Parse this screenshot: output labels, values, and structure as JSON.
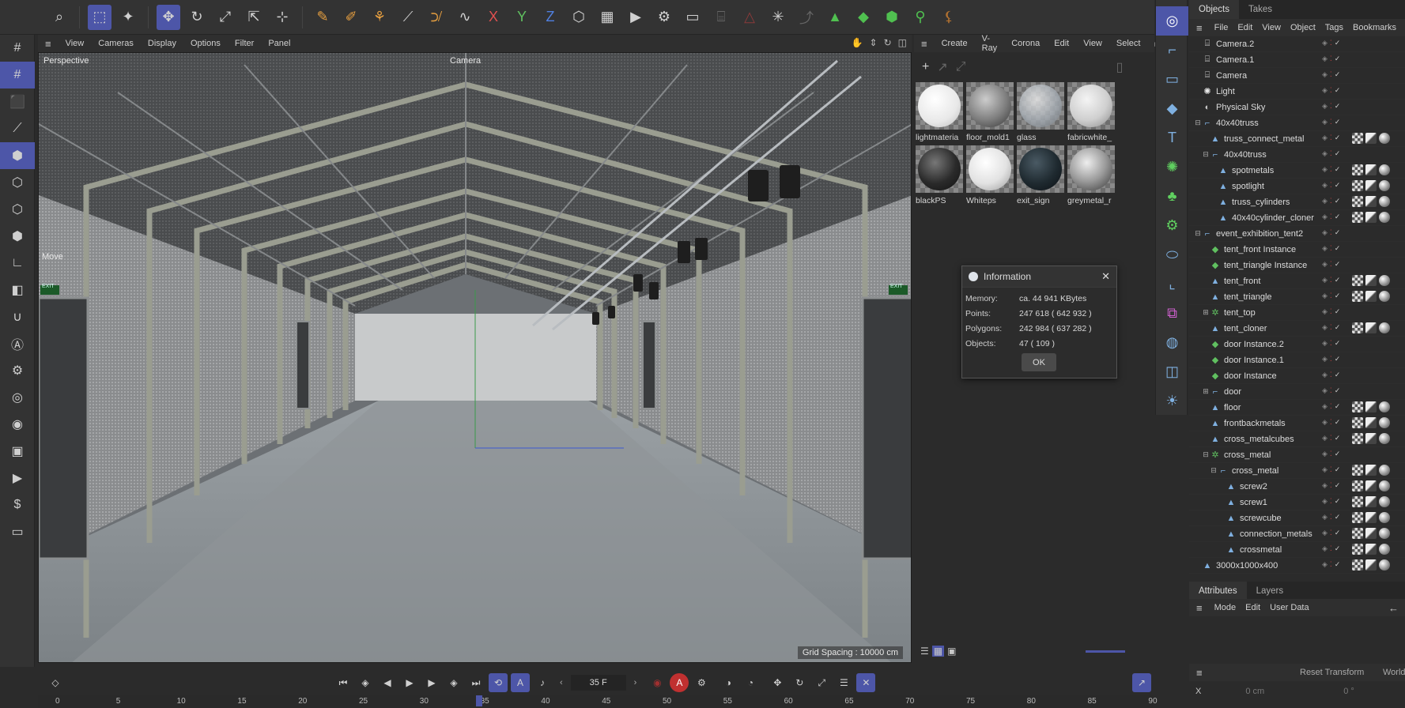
{
  "top_toolbar": {
    "axis_x": "X",
    "axis_y": "Y",
    "axis_z": "Z",
    "icons": [
      "search-icon",
      "live-selection-icon",
      "select-tool-icon",
      "move-icon",
      "rotate-icon",
      "scale-icon",
      "transform-icon",
      "snap-icon",
      "spline-pen-icon",
      "sketch-icon",
      "spline-icon",
      "brush-icon",
      "paint-icon",
      "spline-smooth-icon",
      "axis-x-icon",
      "axis-y-icon",
      "axis-z-icon",
      "coordinate-system-icon",
      "clapboard-icon",
      "render-view-icon",
      "render-settings-icon",
      "render-queue-icon",
      "lock-icon",
      "symmetry-icon",
      "workplane-icon",
      "snapping-icon",
      "cube-icon",
      "cube-green-icon",
      "cube-outline-icon",
      "deformer-icon",
      "joint-icon"
    ]
  },
  "viewport": {
    "menu": [
      "View",
      "Cameras",
      "Display",
      "Options",
      "Filter",
      "Panel"
    ],
    "view_name": "Perspective",
    "camera_label": "Camera",
    "move_label": "Move",
    "grid_spacing": "Grid Spacing : 10000 cm",
    "exit_sign": "EXIT"
  },
  "material_manager": {
    "menu": [
      "Create",
      "V-Ray",
      "Corona",
      "Edit",
      "View",
      "Select"
    ],
    "materials": [
      {
        "name": "lightmateria",
        "color": "#f4f4f4"
      },
      {
        "name": "floor_mold1",
        "color": "#7e7e7e"
      },
      {
        "name": "glass",
        "color": "#b8c0c8"
      },
      {
        "name": "fabricwhite_",
        "color": "#d8d8d8"
      },
      {
        "name": "blackPS",
        "color": "#2a2a2a"
      },
      {
        "name": "Whiteps",
        "color": "#e6e6e6"
      },
      {
        "name": "exit_sign",
        "color": "#1f2a30"
      },
      {
        "name": "greymetal_r",
        "color": "#9a9a9a"
      }
    ]
  },
  "info_dialog": {
    "title": "Information",
    "rows": [
      {
        "key": "Memory:",
        "value": "ca. 44 941 KBytes"
      },
      {
        "key": "Points:",
        "value": "247 618 ( 642 932 )"
      },
      {
        "key": "Polygons:",
        "value": "242 984 ( 637 282 )"
      },
      {
        "key": "Objects:",
        "value": "47 ( 109 )"
      }
    ],
    "ok": "OK"
  },
  "object_manager": {
    "tabs": [
      "Objects",
      "Takes"
    ],
    "menu": [
      "File",
      "Edit",
      "View",
      "Object",
      "Tags",
      "Bookmarks"
    ],
    "rows": [
      {
        "name": "Camera.2",
        "icon": "camera-icon",
        "depth": 0,
        "toggle": ""
      },
      {
        "name": "Camera.1",
        "icon": "camera-icon",
        "depth": 0,
        "toggle": ""
      },
      {
        "name": "Camera",
        "icon": "camera-icon",
        "depth": 0,
        "toggle": ""
      },
      {
        "name": "Light",
        "icon": "light-icon",
        "depth": 0,
        "toggle": ""
      },
      {
        "name": "Physical Sky",
        "icon": "sky-icon",
        "depth": 0,
        "toggle": ""
      },
      {
        "name": "40x40truss",
        "icon": "null-icon",
        "depth": 0,
        "toggle": "⊟"
      },
      {
        "name": "truss_connect_metal",
        "icon": "polygon-icon",
        "depth": 1,
        "toggle": ""
      },
      {
        "name": "40x40truss",
        "icon": "null-icon",
        "depth": 1,
        "toggle": "⊟"
      },
      {
        "name": "spotmetals",
        "icon": "polygon-icon",
        "depth": 2,
        "toggle": ""
      },
      {
        "name": "spotlight",
        "icon": "polygon-icon",
        "depth": 2,
        "toggle": ""
      },
      {
        "name": "truss_cylinders",
        "icon": "polygon-icon",
        "depth": 2,
        "toggle": ""
      },
      {
        "name": "40x40cylinder_cloner",
        "icon": "polygon-icon",
        "depth": 2,
        "toggle": ""
      },
      {
        "name": "event_exhibition_tent2",
        "icon": "null-icon",
        "depth": 0,
        "toggle": "⊟"
      },
      {
        "name": "tent_front Instance",
        "icon": "instance-icon",
        "depth": 1,
        "toggle": ""
      },
      {
        "name": "tent_triangle Instance",
        "icon": "instance-icon",
        "depth": 1,
        "toggle": ""
      },
      {
        "name": "tent_front",
        "icon": "polygon-icon",
        "depth": 1,
        "toggle": ""
      },
      {
        "name": "tent_triangle",
        "icon": "polygon-icon",
        "depth": 1,
        "toggle": ""
      },
      {
        "name": "tent_top",
        "icon": "cloner-icon",
        "depth": 1,
        "toggle": "⊞"
      },
      {
        "name": "tent_cloner",
        "icon": "polygon-icon",
        "depth": 1,
        "toggle": ""
      },
      {
        "name": "door Instance.2",
        "icon": "instance-icon",
        "depth": 1,
        "toggle": ""
      },
      {
        "name": "door Instance.1",
        "icon": "instance-icon",
        "depth": 1,
        "toggle": ""
      },
      {
        "name": "door Instance",
        "icon": "instance-icon",
        "depth": 1,
        "toggle": ""
      },
      {
        "name": "door",
        "icon": "null-icon",
        "depth": 1,
        "toggle": "⊞"
      },
      {
        "name": "floor",
        "icon": "polygon-icon",
        "depth": 1,
        "toggle": ""
      },
      {
        "name": "frontbackmetals",
        "icon": "polygon-icon",
        "depth": 1,
        "toggle": ""
      },
      {
        "name": "cross_metalcubes",
        "icon": "polygon-icon",
        "depth": 1,
        "toggle": ""
      },
      {
        "name": "cross_metal",
        "icon": "cloner-icon",
        "depth": 1,
        "toggle": "⊟"
      },
      {
        "name": "cross_metal",
        "icon": "null-icon",
        "depth": 2,
        "toggle": "⊟"
      },
      {
        "name": "screw2",
        "icon": "polygon-icon",
        "depth": 3,
        "toggle": ""
      },
      {
        "name": "screw1",
        "icon": "polygon-icon",
        "depth": 3,
        "toggle": ""
      },
      {
        "name": "screwcube",
        "icon": "polygon-icon",
        "depth": 3,
        "toggle": ""
      },
      {
        "name": "connection_metals",
        "icon": "polygon-icon",
        "depth": 3,
        "toggle": ""
      },
      {
        "name": "crossmetal",
        "icon": "polygon-icon",
        "depth": 3,
        "toggle": ""
      },
      {
        "name": "3000x1000x400",
        "icon": "polygon-icon",
        "depth": 0,
        "toggle": ""
      }
    ]
  },
  "attributes": {
    "tabs": [
      "Attributes",
      "Layers"
    ],
    "menu": [
      "Mode",
      "Edit",
      "User Data"
    ],
    "reset_transform": "Reset Transform",
    "world": "World",
    "x_label": "X",
    "x_value": "0 cm",
    "x_rot": "0 °"
  },
  "timeline": {
    "current_frame": "35 F",
    "ticks": [
      "0",
      "5",
      "10",
      "15",
      "20",
      "25",
      "30",
      "35",
      "40",
      "45",
      "50",
      "55",
      "60",
      "65",
      "70",
      "75",
      "80",
      "85",
      "90"
    ]
  }
}
